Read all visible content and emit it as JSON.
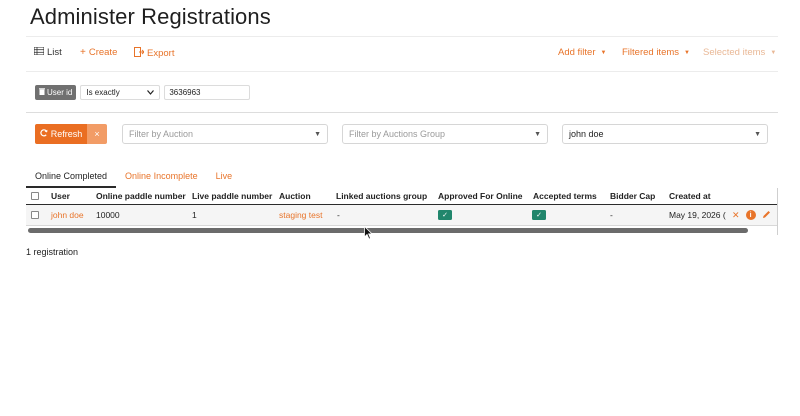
{
  "page": {
    "title": "Administer Registrations"
  },
  "toolbar": {
    "list_label": "List",
    "create_label": "Create",
    "export_label": "Export",
    "add_filter_label": "Add filter",
    "filtered_items_label": "Filtered items",
    "selected_items_label": "Selected items"
  },
  "filter": {
    "field_label": "User id",
    "operator": "Is exactly",
    "value": "3636963"
  },
  "panel": {
    "refresh_label": "Refresh",
    "clear_label": "×",
    "auction_placeholder": "Filter by Auction",
    "group_placeholder": "Filter by Auctions Group",
    "name_value": "john doe"
  },
  "tabs": [
    {
      "label": "Online Completed",
      "active": true
    },
    {
      "label": "Online Incomplete",
      "active": false
    },
    {
      "label": "Live",
      "active": false
    }
  ],
  "table": {
    "headers": [
      "User",
      "Online paddle number",
      "Live paddle number",
      "Auction",
      "Linked auctions group",
      "Approved For Online",
      "Accepted terms",
      "Bidder Cap",
      "Created at"
    ],
    "rows": [
      {
        "user": "john doe",
        "online_paddle": "10000",
        "live_paddle": "1",
        "auction": "staging test",
        "linked_group": "-",
        "approved_online": "✓",
        "accepted_terms": "✓",
        "bidder_cap": "-",
        "created_at": "May 19, 2026 ("
      }
    ]
  },
  "footer": {
    "count_text": "1 registration"
  },
  "icons": {
    "list": "list-icon",
    "create": "plus-icon",
    "export": "export-icon",
    "userid": "trash-icon",
    "refresh": "refresh-icon",
    "info": "info-icon",
    "edit": "pencil-icon",
    "delete": "close-icon"
  },
  "colors": {
    "accent": "#e8742a",
    "success": "#21866c",
    "chip": "#707070"
  }
}
